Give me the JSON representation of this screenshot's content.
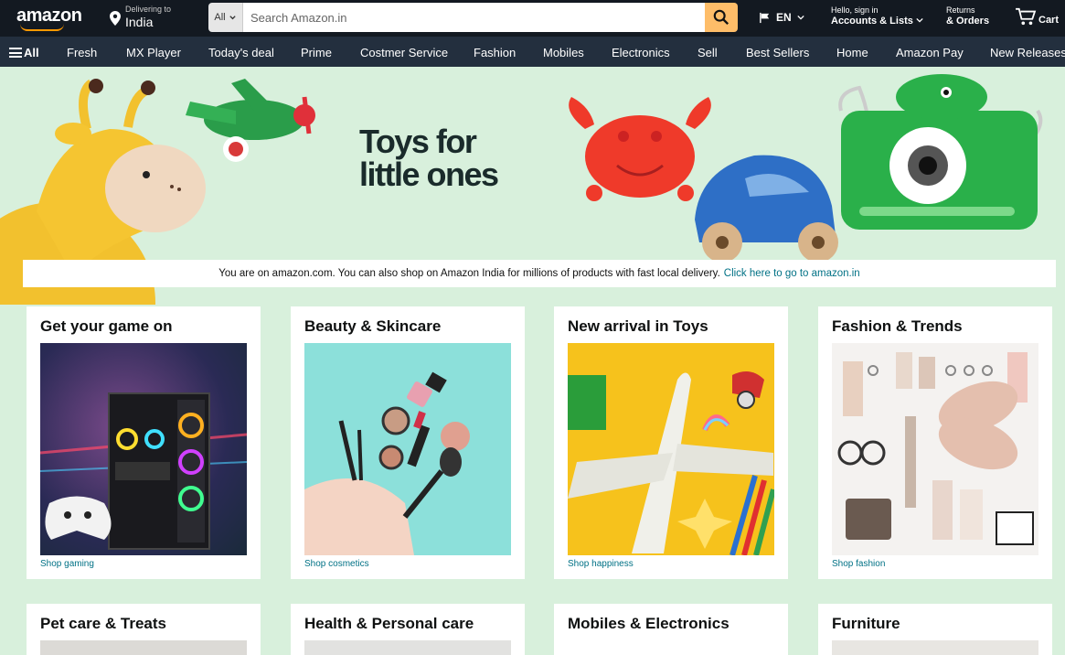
{
  "header": {
    "logo_text": "amazon",
    "deliver_small": "Delivering to",
    "deliver_location": "India",
    "search_category": "All",
    "search_placeholder": "Search Amazon.in",
    "language": "EN",
    "account_small": "Hello, sign in",
    "account_big": "Accounts & Lists",
    "returns_small": "Returns",
    "returns_big": "& Orders",
    "cart_label": "Cart",
    "accent": "#febd69",
    "bg": "#131921"
  },
  "subnav": {
    "all_label": "All",
    "items": [
      "Fresh",
      "MX Player",
      "Today's deal",
      "Prime",
      "Costmer Service",
      "Fashion",
      "Mobiles",
      "Electronics",
      "Sell",
      "Best Sellers",
      "Home",
      "Amazon Pay",
      "New Releases"
    ]
  },
  "hero": {
    "title_line1": "Toys for",
    "title_line2": "little ones"
  },
  "notice": {
    "text": "You are on amazon.com. You can also shop on Amazon India for millions of products with fast local delivery.",
    "link": "Click here to go to amazon.in"
  },
  "cards": [
    {
      "title": "Get your game on",
      "link": "Shop gaming"
    },
    {
      "title": "Beauty & Skincare",
      "link": "Shop cosmetics"
    },
    {
      "title": "New arrival in Toys",
      "link": "Shop happiness"
    },
    {
      "title": "Fashion & Trends",
      "link": "Shop fashion"
    },
    {
      "title": "Pet care & Treats",
      "link": ""
    },
    {
      "title": "Health & Personal care",
      "link": ""
    },
    {
      "title": "Mobiles & Electronics",
      "link": ""
    },
    {
      "title": "Furniture",
      "link": ""
    }
  ]
}
